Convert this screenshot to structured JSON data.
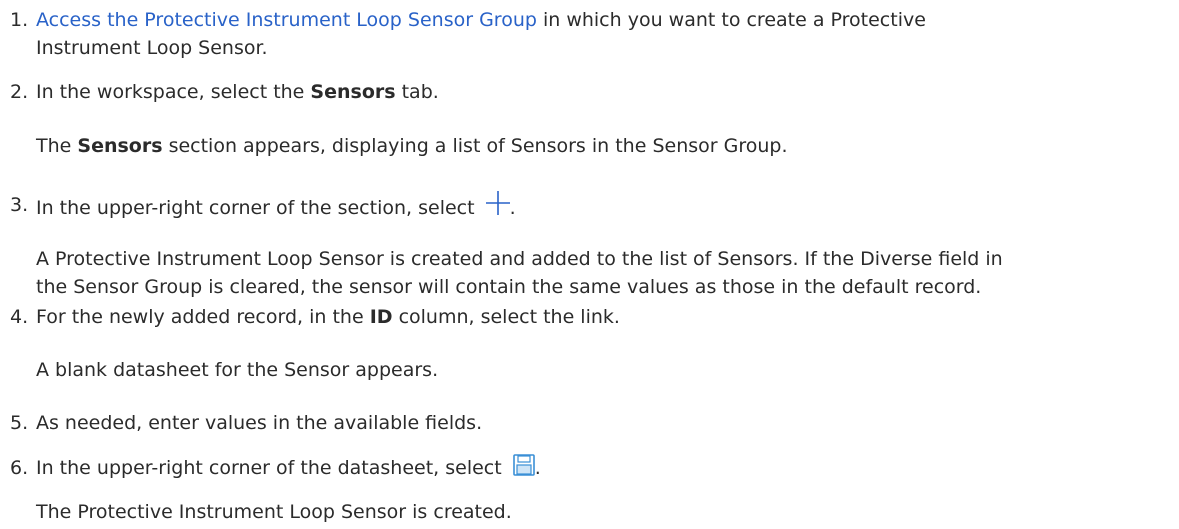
{
  "steps": [
    {
      "number": "1.",
      "link_text": "Access the Protective Instrument Loop Sensor Group",
      "text_after_link": " in which you want to create a Protective",
      "text_line2": "Instrument Loop Sensor."
    },
    {
      "number": "2.",
      "text_before": "In the workspace, select the ",
      "bold": "Sensors",
      "text_after": " tab.",
      "result_bold": "Sensors",
      "result_text": " section appears, displaying a list of Sensors in the Sensor Group.",
      "result_prefix": "The "
    },
    {
      "number": "3.",
      "text_before": "In the upper-right corner of the section, select ",
      "text_after": ".",
      "icon": "plus-icon",
      "result_line1": "A Protective Instrument Loop Sensor is created and added to the list of Sensors. If the Diverse field in",
      "result_line2": "the Sensor Group is cleared, the sensor will contain the same values as those in the default record."
    },
    {
      "number": "4.",
      "text_before": "For the newly added record, in the ",
      "bold": "ID",
      "text_after": " column, select the link.",
      "result": "A blank datasheet for the Sensor appears."
    },
    {
      "number": "5.",
      "text": "As needed, enter values in the available fields."
    },
    {
      "number": "6.",
      "text_before": "In the upper-right corner of the datasheet, select ",
      "text_after": ".",
      "icon": "save-icon",
      "result": "The Protective Instrument Loop Sensor is created."
    }
  ],
  "colors": {
    "text": "#2b2b2b",
    "link": "#2962c8",
    "plus_icon": "#2962c8",
    "save_icon": "#3a8fd6"
  }
}
